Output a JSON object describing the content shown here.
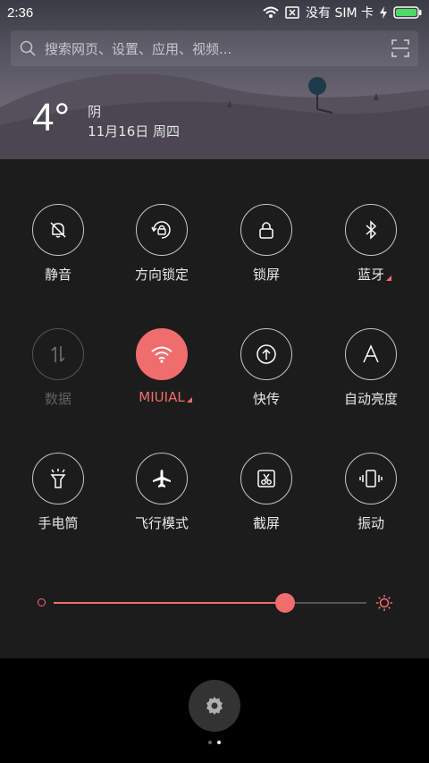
{
  "status": {
    "time": "2:36",
    "carrier": "没有 SIM 卡"
  },
  "search": {
    "placeholder": "搜索网页、设置、应用、视频..."
  },
  "weather": {
    "temperature": "4°",
    "condition": "阴",
    "date": "11月16日 周四"
  },
  "toggles": [
    {
      "label": "静音",
      "icon": "bell-off-icon",
      "state": "off"
    },
    {
      "label": "方向锁定",
      "icon": "rotation-lock-icon",
      "state": "off"
    },
    {
      "label": "锁屏",
      "icon": "lock-icon",
      "state": "off"
    },
    {
      "label": "蓝牙",
      "icon": "bluetooth-icon",
      "state": "off"
    },
    {
      "label": "数据",
      "icon": "mobile-data-icon",
      "state": "disabled"
    },
    {
      "label": "MIUIAL",
      "icon": "wifi-icon",
      "state": "on"
    },
    {
      "label": "快传",
      "icon": "upload-icon",
      "state": "off"
    },
    {
      "label": "自动亮度",
      "icon": "auto-brightness-icon",
      "state": "off"
    },
    {
      "label": "手电筒",
      "icon": "flashlight-icon",
      "state": "off"
    },
    {
      "label": "飞行模式",
      "icon": "airplane-icon",
      "state": "off"
    },
    {
      "label": "截屏",
      "icon": "screenshot-icon",
      "state": "off"
    },
    {
      "label": "振动",
      "icon": "vibrate-icon",
      "state": "off"
    }
  ],
  "brightness": {
    "level": 0.74
  },
  "pager": {
    "pages": 2,
    "current": 2
  },
  "colors": {
    "accent": "#f06d6d",
    "panel": "#1c1c1c"
  }
}
